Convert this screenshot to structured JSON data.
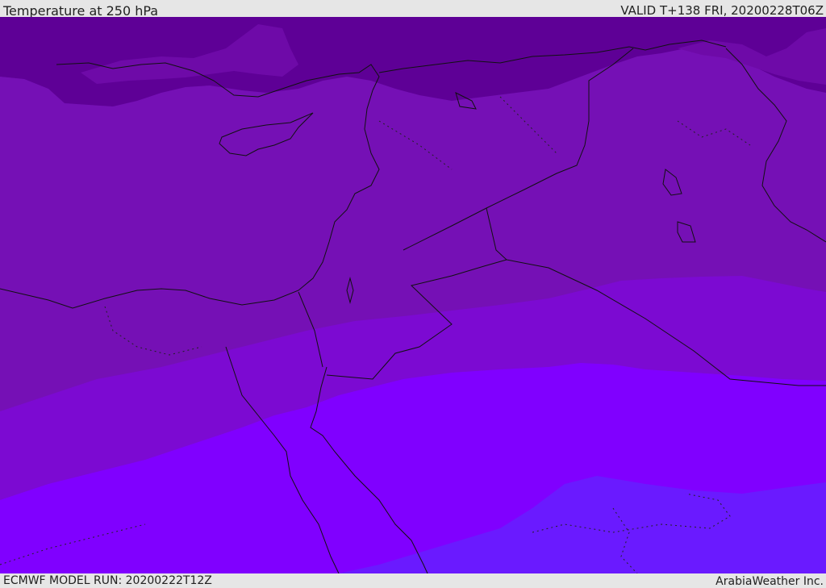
{
  "header": {
    "title": "Temperature at 250 hPa",
    "valid": "VALID T+138 FRI, 20200228T06Z"
  },
  "footer": {
    "model_run": "ECMWF MODEL RUN: 20200222T12Z",
    "credit": "ArabiaWeather Inc."
  },
  "colors": {
    "band_coldest": "#5e0096",
    "band_cold": "#6e0aa8",
    "band_mid": "#7510b5",
    "band_warmer": "#7c0ad2",
    "band_warm": "#8000ff",
    "band_warmest": "#6a1aff",
    "boundary": "#111111"
  }
}
